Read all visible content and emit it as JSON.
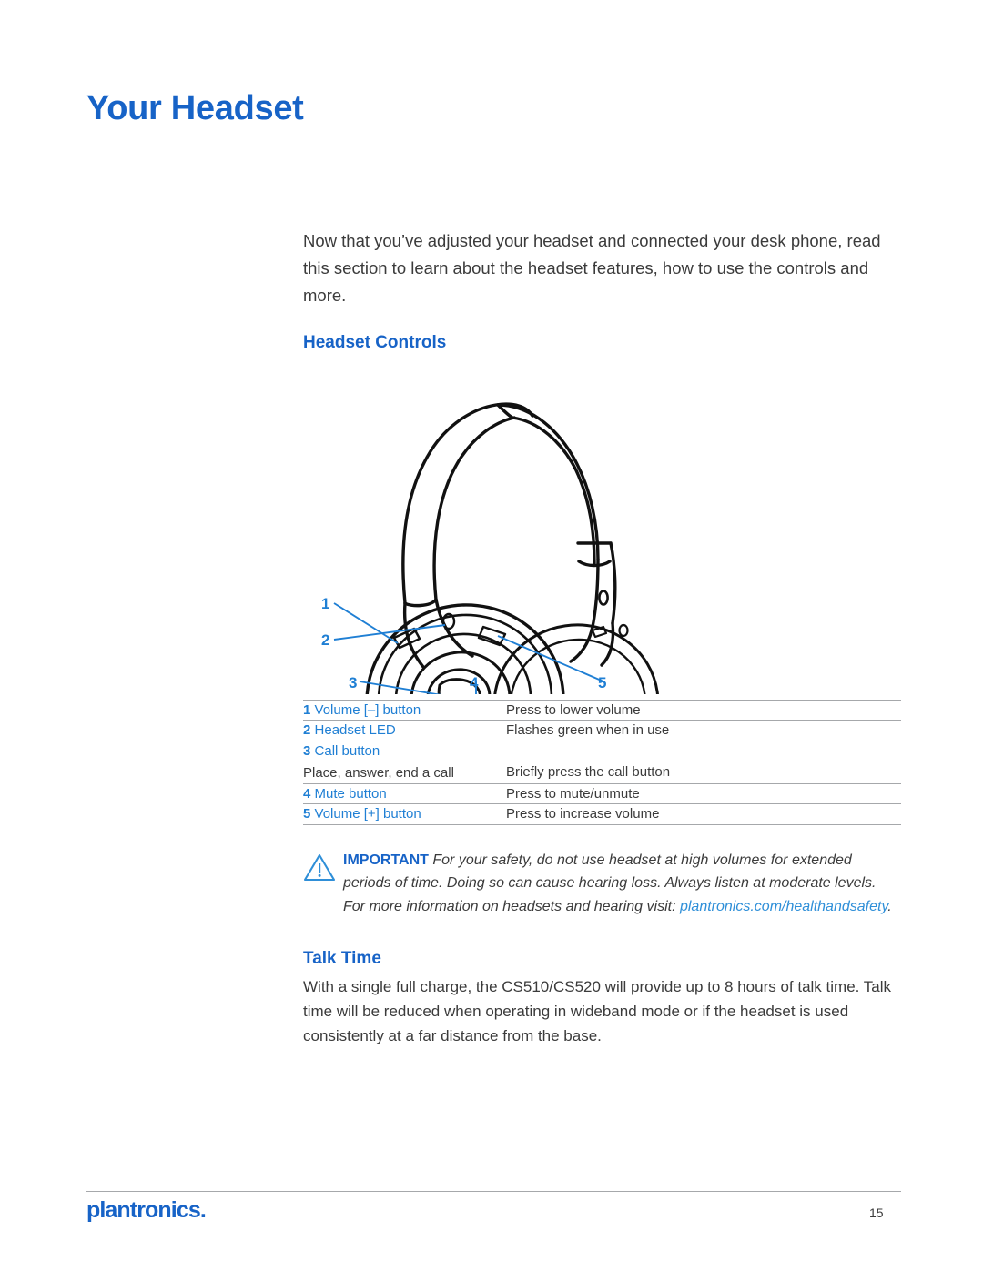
{
  "document": {
    "title": "Your Headset",
    "accent_color": "#1763c7",
    "link_color": "#2f8fd8",
    "body_color": "#3b3b3b",
    "rule_color": "#a6a8ab"
  },
  "intro": {
    "paragraph": "Now that you’ve adjusted your headset and connected your desk phone, read this section to learn about the headset features, how to use the controls and more."
  },
  "headset_controls": {
    "heading": "Headset Controls",
    "figure": {
      "alt": "Line drawing of the CS500 series stereo headset showing the control buttons on the earpiece and the microphone boom",
      "callouts": [
        {
          "number": "1",
          "target": "Volume [–] button"
        },
        {
          "number": "2",
          "target": "Headset LED"
        },
        {
          "number": "3",
          "target": "Call button"
        },
        {
          "number": "4",
          "target": "Mute button"
        },
        {
          "number": "5",
          "target": "Volume [+] button"
        }
      ]
    },
    "rows": [
      {
        "num": "1",
        "label": "Volume [–] button",
        "sublabel": "",
        "description": "Press to lower volume"
      },
      {
        "num": "2",
        "label": "Headset LED",
        "sublabel": "",
        "description": "Flashes green when in use"
      },
      {
        "num": "3",
        "label": "Call button",
        "sublabel": "Place, answer, end a call",
        "description": "Briefly press the call button"
      },
      {
        "num": "4",
        "label": "Mute button",
        "sublabel": "",
        "description": "Press to mute/unmute"
      },
      {
        "num": "5",
        "label": "Volume [+] button",
        "sublabel": "",
        "description": "Press to increase volume"
      }
    ]
  },
  "important_note": {
    "keyword": "IMPORTANT",
    "text_before_link": " For your safety, do not use headset at high volumes for extended periods of time. Doing so can cause hearing loss. Always listen at moderate levels. For more information on headsets and hearing visit: ",
    "link_text": "plantronics.com/healthandsafety",
    "text_after_link": "."
  },
  "talk_time": {
    "heading": "Talk Time",
    "paragraph": "With a single full charge, the CS510/CS520 will provide up to 8 hours of talk time. Talk time will be reduced when operating in wideband mode or if the headset is used consistently at a far distance from the base."
  },
  "footer": {
    "logo_text": "plantronics.",
    "page_number": "15"
  }
}
